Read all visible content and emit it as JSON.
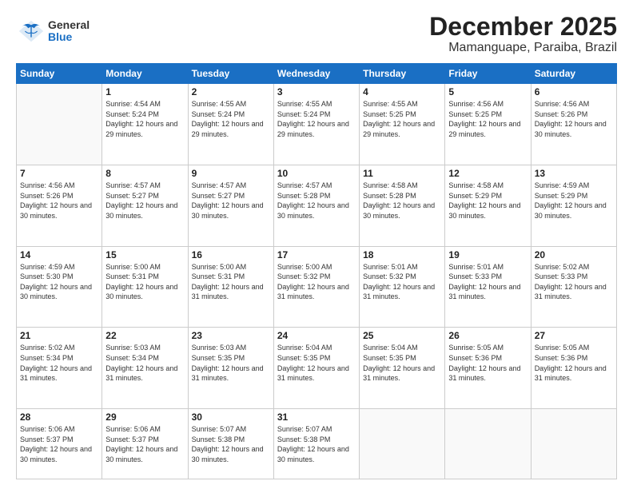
{
  "logo": {
    "general": "General",
    "blue": "Blue"
  },
  "header": {
    "month": "December 2025",
    "location": "Mamanguape, Paraiba, Brazil"
  },
  "weekdays": [
    "Sunday",
    "Monday",
    "Tuesday",
    "Wednesday",
    "Thursday",
    "Friday",
    "Saturday"
  ],
  "weeks": [
    [
      {
        "day": "",
        "empty": true
      },
      {
        "day": "1",
        "sunrise": "4:54 AM",
        "sunset": "5:24 PM",
        "daylight": "12 hours and 29 minutes."
      },
      {
        "day": "2",
        "sunrise": "4:55 AM",
        "sunset": "5:24 PM",
        "daylight": "12 hours and 29 minutes."
      },
      {
        "day": "3",
        "sunrise": "4:55 AM",
        "sunset": "5:24 PM",
        "daylight": "12 hours and 29 minutes."
      },
      {
        "day": "4",
        "sunrise": "4:55 AM",
        "sunset": "5:25 PM",
        "daylight": "12 hours and 29 minutes."
      },
      {
        "day": "5",
        "sunrise": "4:56 AM",
        "sunset": "5:25 PM",
        "daylight": "12 hours and 29 minutes."
      },
      {
        "day": "6",
        "sunrise": "4:56 AM",
        "sunset": "5:26 PM",
        "daylight": "12 hours and 30 minutes."
      }
    ],
    [
      {
        "day": "7",
        "sunrise": "4:56 AM",
        "sunset": "5:26 PM",
        "daylight": "12 hours and 30 minutes."
      },
      {
        "day": "8",
        "sunrise": "4:57 AM",
        "sunset": "5:27 PM",
        "daylight": "12 hours and 30 minutes."
      },
      {
        "day": "9",
        "sunrise": "4:57 AM",
        "sunset": "5:27 PM",
        "daylight": "12 hours and 30 minutes."
      },
      {
        "day": "10",
        "sunrise": "4:57 AM",
        "sunset": "5:28 PM",
        "daylight": "12 hours and 30 minutes."
      },
      {
        "day": "11",
        "sunrise": "4:58 AM",
        "sunset": "5:28 PM",
        "daylight": "12 hours and 30 minutes."
      },
      {
        "day": "12",
        "sunrise": "4:58 AM",
        "sunset": "5:29 PM",
        "daylight": "12 hours and 30 minutes."
      },
      {
        "day": "13",
        "sunrise": "4:59 AM",
        "sunset": "5:29 PM",
        "daylight": "12 hours and 30 minutes."
      }
    ],
    [
      {
        "day": "14",
        "sunrise": "4:59 AM",
        "sunset": "5:30 PM",
        "daylight": "12 hours and 30 minutes."
      },
      {
        "day": "15",
        "sunrise": "5:00 AM",
        "sunset": "5:31 PM",
        "daylight": "12 hours and 30 minutes."
      },
      {
        "day": "16",
        "sunrise": "5:00 AM",
        "sunset": "5:31 PM",
        "daylight": "12 hours and 31 minutes."
      },
      {
        "day": "17",
        "sunrise": "5:00 AM",
        "sunset": "5:32 PM",
        "daylight": "12 hours and 31 minutes."
      },
      {
        "day": "18",
        "sunrise": "5:01 AM",
        "sunset": "5:32 PM",
        "daylight": "12 hours and 31 minutes."
      },
      {
        "day": "19",
        "sunrise": "5:01 AM",
        "sunset": "5:33 PM",
        "daylight": "12 hours and 31 minutes."
      },
      {
        "day": "20",
        "sunrise": "5:02 AM",
        "sunset": "5:33 PM",
        "daylight": "12 hours and 31 minutes."
      }
    ],
    [
      {
        "day": "21",
        "sunrise": "5:02 AM",
        "sunset": "5:34 PM",
        "daylight": "12 hours and 31 minutes."
      },
      {
        "day": "22",
        "sunrise": "5:03 AM",
        "sunset": "5:34 PM",
        "daylight": "12 hours and 31 minutes."
      },
      {
        "day": "23",
        "sunrise": "5:03 AM",
        "sunset": "5:35 PM",
        "daylight": "12 hours and 31 minutes."
      },
      {
        "day": "24",
        "sunrise": "5:04 AM",
        "sunset": "5:35 PM",
        "daylight": "12 hours and 31 minutes."
      },
      {
        "day": "25",
        "sunrise": "5:04 AM",
        "sunset": "5:35 PM",
        "daylight": "12 hours and 31 minutes."
      },
      {
        "day": "26",
        "sunrise": "5:05 AM",
        "sunset": "5:36 PM",
        "daylight": "12 hours and 31 minutes."
      },
      {
        "day": "27",
        "sunrise": "5:05 AM",
        "sunset": "5:36 PM",
        "daylight": "12 hours and 31 minutes."
      }
    ],
    [
      {
        "day": "28",
        "sunrise": "5:06 AM",
        "sunset": "5:37 PM",
        "daylight": "12 hours and 30 minutes."
      },
      {
        "day": "29",
        "sunrise": "5:06 AM",
        "sunset": "5:37 PM",
        "daylight": "12 hours and 30 minutes."
      },
      {
        "day": "30",
        "sunrise": "5:07 AM",
        "sunset": "5:38 PM",
        "daylight": "12 hours and 30 minutes."
      },
      {
        "day": "31",
        "sunrise": "5:07 AM",
        "sunset": "5:38 PM",
        "daylight": "12 hours and 30 minutes."
      },
      {
        "day": "",
        "empty": true
      },
      {
        "day": "",
        "empty": true
      },
      {
        "day": "",
        "empty": true
      }
    ]
  ]
}
